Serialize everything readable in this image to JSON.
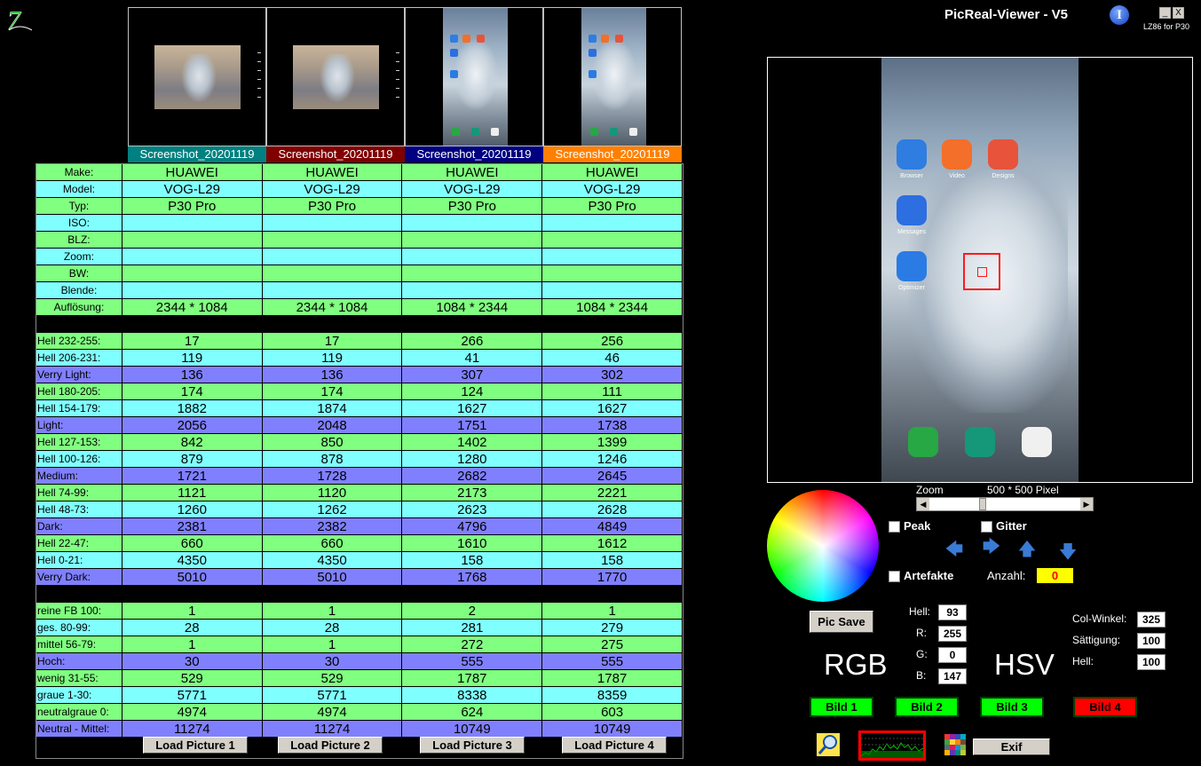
{
  "window": {
    "title": "PicReal-Viewer - V5",
    "subtitle": "LZ86 for P30",
    "info_glyph": "I",
    "minimize": "_",
    "close": "X"
  },
  "thumbnails": [
    {
      "label": "Screenshot_20201119",
      "color": "#008080",
      "orientation": "landscape"
    },
    {
      "label": "Screenshot_20201119",
      "color": "#800000",
      "orientation": "landscape"
    },
    {
      "label": "Screenshot_20201119",
      "color": "#000080",
      "orientation": "portrait"
    },
    {
      "label": "Screenshot_20201119",
      "color": "#ff8000",
      "orientation": "portrait"
    }
  ],
  "table": {
    "rows": [
      {
        "label": "Make:",
        "align": "center",
        "bg": "g",
        "values": [
          "HUAWEI",
          "HUAWEI",
          "HUAWEI",
          "HUAWEI"
        ]
      },
      {
        "label": "Model:",
        "align": "center",
        "bg": "c",
        "values": [
          "VOG-L29",
          "VOG-L29",
          "VOG-L29",
          "VOG-L29"
        ]
      },
      {
        "label": "Typ:",
        "align": "center",
        "bg": "g",
        "values": [
          "P30 Pro",
          "P30 Pro",
          "P30 Pro",
          "P30 Pro"
        ]
      },
      {
        "label": "ISO:",
        "align": "center",
        "bg": "c",
        "values": [
          "",
          "",
          "",
          ""
        ]
      },
      {
        "label": "BLZ:",
        "align": "center",
        "bg": "g",
        "values": [
          "",
          "",
          "",
          ""
        ]
      },
      {
        "label": "Zoom:",
        "align": "center",
        "bg": "c",
        "values": [
          "",
          "",
          "",
          ""
        ]
      },
      {
        "label": "BW:",
        "align": "center",
        "bg": "g",
        "values": [
          "",
          "",
          "",
          ""
        ]
      },
      {
        "label": "Blende:",
        "align": "center",
        "bg": "c",
        "values": [
          "",
          "",
          "",
          ""
        ]
      },
      {
        "label": "Auflösung:",
        "align": "center",
        "bg": "g",
        "values": [
          "2344 * 1084",
          "2344 * 1084",
          "1084 * 2344",
          "1084 * 2344"
        ]
      },
      {
        "label": "",
        "align": "left",
        "bg": "k",
        "values": [
          "",
          "",
          "",
          ""
        ]
      },
      {
        "label": "Hell 232-255:",
        "align": "left",
        "bg": "g",
        "values": [
          "17",
          "17",
          "266",
          "256"
        ]
      },
      {
        "label": "Hell 206-231:",
        "align": "left",
        "bg": "c",
        "values": [
          "119",
          "119",
          "41",
          "46"
        ]
      },
      {
        "label": "Verry Light:",
        "align": "left",
        "bg": "b",
        "values": [
          "136",
          "136",
          "307",
          "302"
        ]
      },
      {
        "label": "Hell 180-205:",
        "align": "left",
        "bg": "g",
        "values": [
          "174",
          "174",
          "124",
          "111"
        ]
      },
      {
        "label": "Hell 154-179:",
        "align": "left",
        "bg": "c",
        "values": [
          "1882",
          "1874",
          "1627",
          "1627"
        ]
      },
      {
        "label": "Light:",
        "align": "left",
        "bg": "b",
        "values": [
          "2056",
          "2048",
          "1751",
          "1738"
        ]
      },
      {
        "label": "Hell 127-153:",
        "align": "left",
        "bg": "g",
        "values": [
          "842",
          "850",
          "1402",
          "1399"
        ]
      },
      {
        "label": "Hell 100-126:",
        "align": "left",
        "bg": "c",
        "values": [
          "879",
          "878",
          "1280",
          "1246"
        ]
      },
      {
        "label": "Medium:",
        "align": "left",
        "bg": "b",
        "values": [
          "1721",
          "1728",
          "2682",
          "2645"
        ]
      },
      {
        "label": "Hell 74-99:",
        "align": "left",
        "bg": "g",
        "values": [
          "1121",
          "1120",
          "2173",
          "2221"
        ]
      },
      {
        "label": "Hell 48-73:",
        "align": "left",
        "bg": "c",
        "values": [
          "1260",
          "1262",
          "2623",
          "2628"
        ]
      },
      {
        "label": "Dark:",
        "align": "left",
        "bg": "b",
        "values": [
          "2381",
          "2382",
          "4796",
          "4849"
        ]
      },
      {
        "label": "Hell 22-47:",
        "align": "left",
        "bg": "g",
        "values": [
          "660",
          "660",
          "1610",
          "1612"
        ]
      },
      {
        "label": "Hell 0-21:",
        "align": "left",
        "bg": "c",
        "values": [
          "4350",
          "4350",
          "158",
          "158"
        ]
      },
      {
        "label": "Verry Dark:",
        "align": "left",
        "bg": "b",
        "values": [
          "5010",
          "5010",
          "1768",
          "1770"
        ]
      },
      {
        "label": "",
        "align": "left",
        "bg": "k",
        "values": [
          "",
          "",
          "",
          ""
        ]
      },
      {
        "label": "reine FB 100:",
        "align": "left",
        "bg": "g",
        "values": [
          "1",
          "1",
          "2",
          "1"
        ]
      },
      {
        "label": "ges. 80-99:",
        "align": "left",
        "bg": "c",
        "values": [
          "28",
          "28",
          "281",
          "279"
        ]
      },
      {
        "label": "mittel 56-79:",
        "align": "left",
        "bg": "g",
        "values": [
          "1",
          "1",
          "272",
          "275"
        ]
      },
      {
        "label": "Hoch:",
        "align": "left",
        "bg": "b",
        "values": [
          "30",
          "30",
          "555",
          "555"
        ]
      },
      {
        "label": "wenig 31-55:",
        "align": "left",
        "bg": "g",
        "values": [
          "529",
          "529",
          "1787",
          "1787"
        ]
      },
      {
        "label": "graue  1-30:",
        "align": "left",
        "bg": "c",
        "values": [
          "5771",
          "5771",
          "8338",
          "8359"
        ]
      },
      {
        "label": "neutralgraue 0:",
        "align": "left",
        "bg": "g",
        "values": [
          "4974",
          "4974",
          "624",
          "603"
        ]
      },
      {
        "label": "Neutral - Mittel:",
        "align": "left",
        "bg": "b",
        "values": [
          "11274",
          "11274",
          "10749",
          "10749"
        ]
      }
    ]
  },
  "load_buttons": [
    "Load Picture 1",
    "Load Picture 2",
    "Load Picture 3",
    "Load Picture 4"
  ],
  "preview": {
    "apps": [
      {
        "label": "Browser",
        "color": "#2f7de1"
      },
      {
        "label": "Video",
        "color": "#f36f2a"
      },
      {
        "label": "Designs",
        "color": "#e8533b"
      },
      {
        "label": "Messages",
        "color": "#2d6ee0"
      },
      {
        "label": "Optimizer",
        "color": "#2a7be4"
      }
    ]
  },
  "zoom": {
    "label": "Zoom",
    "pixel_label": "500 * 500 Pixel",
    "level_fraction": 0.34
  },
  "checks": {
    "peak": "Peak",
    "gitter": "Gitter",
    "artefakte": "Artefakte"
  },
  "count": {
    "label": "Anzahl:",
    "value": "0"
  },
  "pic_save": "Pic Save",
  "rgb": {
    "hell_label": "Hell:",
    "hell": "93",
    "r_label": "R:",
    "r": "255",
    "g_label": "G:",
    "g": "0",
    "b_label": "B:",
    "b": "147",
    "big": "RGB"
  },
  "hsv": {
    "winkel_label": "Col-Winkel:",
    "winkel": "325",
    "sat_label": "Sättigung:",
    "sat": "100",
    "hell_label": "Hell:",
    "hell": "100",
    "big": "HSV"
  },
  "bild_buttons": [
    {
      "label": "Bild 1",
      "color": "#00ff00"
    },
    {
      "label": "Bild 2",
      "color": "#00ff00"
    },
    {
      "label": "Bild 3",
      "color": "#00ff00"
    },
    {
      "label": "Bild 4",
      "color": "#ff0000"
    }
  ],
  "exif": "Exif",
  "icons": {
    "magnifier": "magnifier-icon",
    "histogram": "histogram-icon",
    "palette": "palette-icon",
    "logo": "logo-icon"
  }
}
